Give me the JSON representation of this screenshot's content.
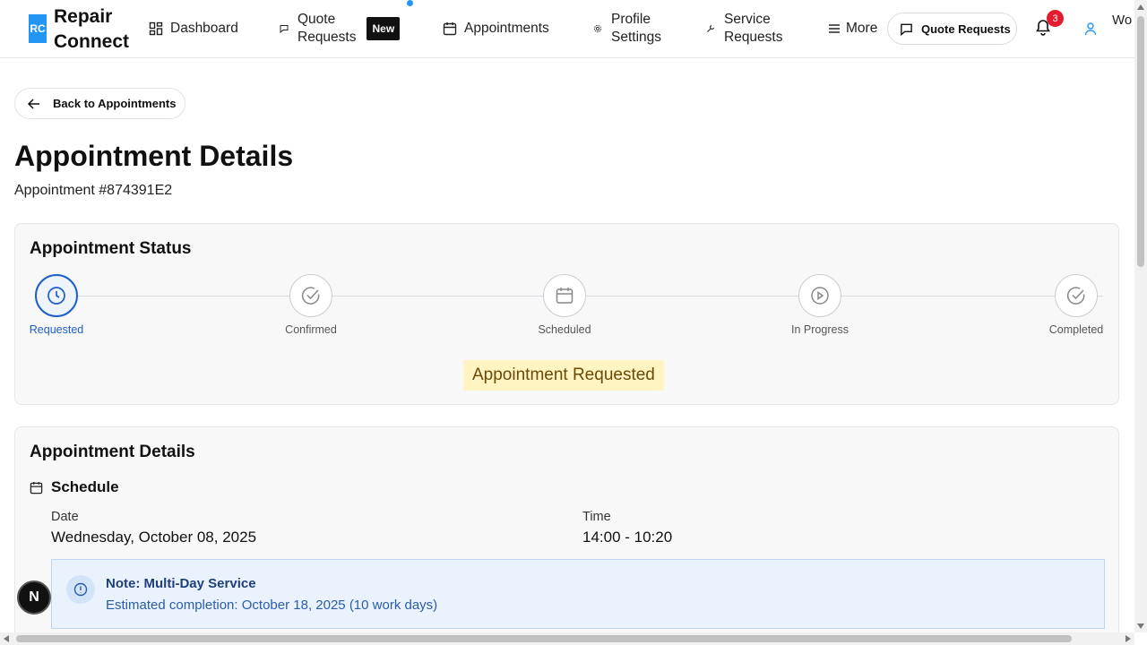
{
  "nav": {
    "logo_text": "RC",
    "brand_line1": "Repair",
    "brand_line2": "Connect",
    "items": [
      {
        "label": "Dashboard",
        "icon": "dashboard-icon"
      },
      {
        "label_line1": "Quote",
        "label_line2": "Requests",
        "badge": "New",
        "icon": "message-icon"
      },
      {
        "label": "Appointments",
        "icon": "calendar-icon"
      },
      {
        "label_line1": "Profile",
        "label_line2": "Settings",
        "icon": "gear-icon"
      },
      {
        "label_line1": "Service",
        "label_line2": "Requests",
        "icon": "wrench-icon"
      },
      {
        "label": "More",
        "icon": "menu-icon"
      }
    ],
    "quote_requests_button": "Quote Requests",
    "notification_count": "3",
    "user_text": "Wo"
  },
  "back_button": "Back to Appointments",
  "page": {
    "title": "Appointment Details",
    "subtitle": "Appointment #874391E2"
  },
  "status_card": {
    "title": "Appointment Status",
    "steps": [
      {
        "label": "Requested",
        "icon": "clock-icon",
        "active": true
      },
      {
        "label": "Confirmed",
        "icon": "check-circle-icon",
        "active": false
      },
      {
        "label": "Scheduled",
        "icon": "calendar-icon",
        "active": false
      },
      {
        "label": "In Progress",
        "icon": "play-circle-icon",
        "active": false
      },
      {
        "label": "Completed",
        "icon": "check-circle-icon",
        "active": false
      }
    ],
    "status_text": "Appointment Requested"
  },
  "details_card": {
    "title": "Appointment Details",
    "schedule_heading": "Schedule",
    "date_label": "Date",
    "date_value": "Wednesday, October 08, 2025",
    "time_label": "Time",
    "time_value": "14:00 - 10:20",
    "note_title": "Note: Multi-Day Service",
    "note_text": "Estimated completion: October 18, 2025 (10 work days)"
  },
  "fab_label": "N",
  "colors": {
    "accent": "#1e5fc9",
    "brand": "#2196f3",
    "status_bg": "#fff4c2",
    "badge_red": "#e11d2e"
  }
}
